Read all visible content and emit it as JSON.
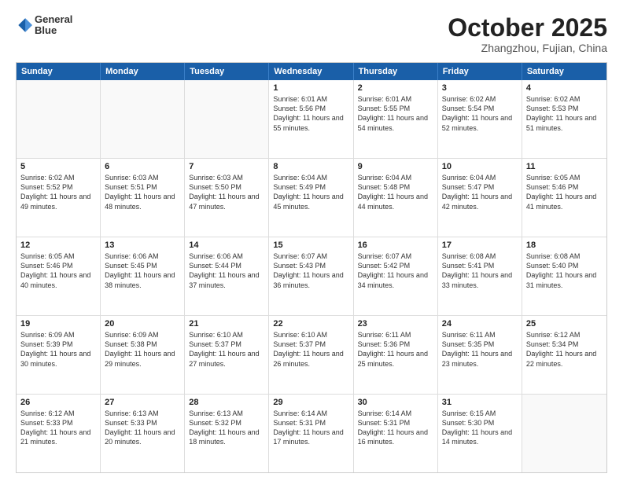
{
  "header": {
    "logo_line1": "General",
    "logo_line2": "Blue",
    "month": "October 2025",
    "location": "Zhangzhou, Fujian, China"
  },
  "weekdays": [
    "Sunday",
    "Monday",
    "Tuesday",
    "Wednesday",
    "Thursday",
    "Friday",
    "Saturday"
  ],
  "rows": [
    [
      {
        "day": "",
        "text": ""
      },
      {
        "day": "",
        "text": ""
      },
      {
        "day": "",
        "text": ""
      },
      {
        "day": "1",
        "text": "Sunrise: 6:01 AM\nSunset: 5:56 PM\nDaylight: 11 hours\nand 55 minutes."
      },
      {
        "day": "2",
        "text": "Sunrise: 6:01 AM\nSunset: 5:55 PM\nDaylight: 11 hours\nand 54 minutes."
      },
      {
        "day": "3",
        "text": "Sunrise: 6:02 AM\nSunset: 5:54 PM\nDaylight: 11 hours\nand 52 minutes."
      },
      {
        "day": "4",
        "text": "Sunrise: 6:02 AM\nSunset: 5:53 PM\nDaylight: 11 hours\nand 51 minutes."
      }
    ],
    [
      {
        "day": "5",
        "text": "Sunrise: 6:02 AM\nSunset: 5:52 PM\nDaylight: 11 hours\nand 49 minutes."
      },
      {
        "day": "6",
        "text": "Sunrise: 6:03 AM\nSunset: 5:51 PM\nDaylight: 11 hours\nand 48 minutes."
      },
      {
        "day": "7",
        "text": "Sunrise: 6:03 AM\nSunset: 5:50 PM\nDaylight: 11 hours\nand 47 minutes."
      },
      {
        "day": "8",
        "text": "Sunrise: 6:04 AM\nSunset: 5:49 PM\nDaylight: 11 hours\nand 45 minutes."
      },
      {
        "day": "9",
        "text": "Sunrise: 6:04 AM\nSunset: 5:48 PM\nDaylight: 11 hours\nand 44 minutes."
      },
      {
        "day": "10",
        "text": "Sunrise: 6:04 AM\nSunset: 5:47 PM\nDaylight: 11 hours\nand 42 minutes."
      },
      {
        "day": "11",
        "text": "Sunrise: 6:05 AM\nSunset: 5:46 PM\nDaylight: 11 hours\nand 41 minutes."
      }
    ],
    [
      {
        "day": "12",
        "text": "Sunrise: 6:05 AM\nSunset: 5:46 PM\nDaylight: 11 hours\nand 40 minutes."
      },
      {
        "day": "13",
        "text": "Sunrise: 6:06 AM\nSunset: 5:45 PM\nDaylight: 11 hours\nand 38 minutes."
      },
      {
        "day": "14",
        "text": "Sunrise: 6:06 AM\nSunset: 5:44 PM\nDaylight: 11 hours\nand 37 minutes."
      },
      {
        "day": "15",
        "text": "Sunrise: 6:07 AM\nSunset: 5:43 PM\nDaylight: 11 hours\nand 36 minutes."
      },
      {
        "day": "16",
        "text": "Sunrise: 6:07 AM\nSunset: 5:42 PM\nDaylight: 11 hours\nand 34 minutes."
      },
      {
        "day": "17",
        "text": "Sunrise: 6:08 AM\nSunset: 5:41 PM\nDaylight: 11 hours\nand 33 minutes."
      },
      {
        "day": "18",
        "text": "Sunrise: 6:08 AM\nSunset: 5:40 PM\nDaylight: 11 hours\nand 31 minutes."
      }
    ],
    [
      {
        "day": "19",
        "text": "Sunrise: 6:09 AM\nSunset: 5:39 PM\nDaylight: 11 hours\nand 30 minutes."
      },
      {
        "day": "20",
        "text": "Sunrise: 6:09 AM\nSunset: 5:38 PM\nDaylight: 11 hours\nand 29 minutes."
      },
      {
        "day": "21",
        "text": "Sunrise: 6:10 AM\nSunset: 5:37 PM\nDaylight: 11 hours\nand 27 minutes."
      },
      {
        "day": "22",
        "text": "Sunrise: 6:10 AM\nSunset: 5:37 PM\nDaylight: 11 hours\nand 26 minutes."
      },
      {
        "day": "23",
        "text": "Sunrise: 6:11 AM\nSunset: 5:36 PM\nDaylight: 11 hours\nand 25 minutes."
      },
      {
        "day": "24",
        "text": "Sunrise: 6:11 AM\nSunset: 5:35 PM\nDaylight: 11 hours\nand 23 minutes."
      },
      {
        "day": "25",
        "text": "Sunrise: 6:12 AM\nSunset: 5:34 PM\nDaylight: 11 hours\nand 22 minutes."
      }
    ],
    [
      {
        "day": "26",
        "text": "Sunrise: 6:12 AM\nSunset: 5:33 PM\nDaylight: 11 hours\nand 21 minutes."
      },
      {
        "day": "27",
        "text": "Sunrise: 6:13 AM\nSunset: 5:33 PM\nDaylight: 11 hours\nand 20 minutes."
      },
      {
        "day": "28",
        "text": "Sunrise: 6:13 AM\nSunset: 5:32 PM\nDaylight: 11 hours\nand 18 minutes."
      },
      {
        "day": "29",
        "text": "Sunrise: 6:14 AM\nSunset: 5:31 PM\nDaylight: 11 hours\nand 17 minutes."
      },
      {
        "day": "30",
        "text": "Sunrise: 6:14 AM\nSunset: 5:31 PM\nDaylight: 11 hours\nand 16 minutes."
      },
      {
        "day": "31",
        "text": "Sunrise: 6:15 AM\nSunset: 5:30 PM\nDaylight: 11 hours\nand 14 minutes."
      },
      {
        "day": "",
        "text": ""
      }
    ]
  ]
}
